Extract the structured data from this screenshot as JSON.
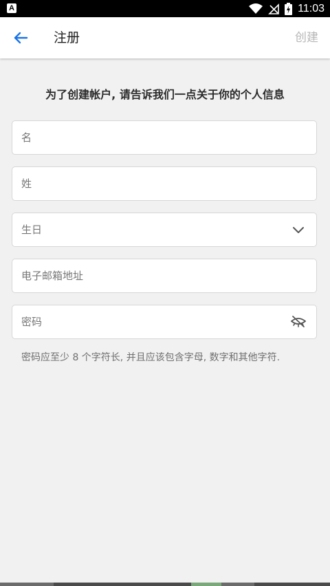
{
  "status_bar": {
    "time": "11:03",
    "left_icon_letter": "A",
    "battery_glyph": "⚡"
  },
  "app_bar": {
    "title": "注册",
    "action": "创建"
  },
  "form": {
    "heading": "为了创建帐户, 请告诉我们一点关于你的个人信息",
    "first_name_placeholder": "名",
    "last_name_placeholder": "姓",
    "birthday_placeholder": "生日",
    "email_placeholder": "电子邮箱地址",
    "password_placeholder": "密码",
    "password_hint": "密码应至少 8 个字符长, 并且应该包含字母, 数字和其他字符."
  },
  "colors": {
    "accent": "#1a73e8",
    "disabled_action": "#b6b6b6",
    "background": "#f1f1f1"
  },
  "icons": {
    "back": "arrow-back-icon",
    "dropdown": "chevron-down-icon",
    "visibility": "visibility-off-icon"
  }
}
